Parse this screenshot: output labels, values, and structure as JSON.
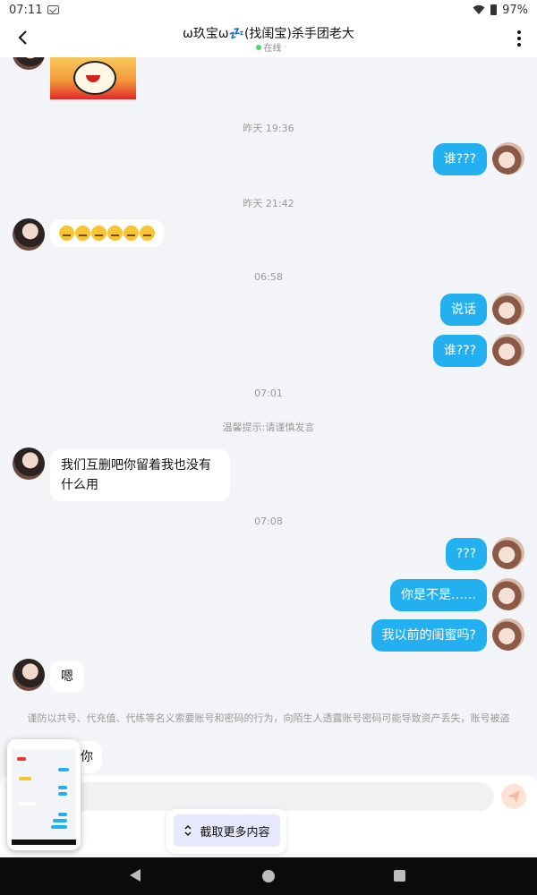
{
  "status_bar": {
    "time": "07:11",
    "battery": "97%"
  },
  "header": {
    "title": "ω玖宝ω💤(找闺宝)杀手团老大",
    "status": "在线"
  },
  "chat": {
    "timestamps": [
      "昨天 19:36",
      "昨天 21:42",
      "06:58",
      "07:01",
      "07:08"
    ],
    "warning_tip": "温馨提示:请谨慎发言",
    "security_notice": "谨防以共号、代充值、代练等名义索要账号和密码的行为，向陌生人透露账号密码可能导致资产丢失，账号被盗",
    "messages": {
      "out_1": "谁???",
      "out_2": "说话",
      "out_3": "谁???",
      "in_long": "我们互删吧你留着我也没有什么用",
      "out_4": "???",
      "out_5": "你是不是……",
      "out_6": "我以前的闺蜜吗?",
      "in_short": "嗯",
      "in_partial": "你"
    },
    "emoji_icons": [
      "persevering-face",
      "persevering-face",
      "persevering-face",
      "persevering-face",
      "persevering-face",
      "persevering-face"
    ]
  },
  "bottom": {
    "capture_label": "截取更多内容"
  },
  "colors": {
    "out_bubble": "#23b0f0",
    "in_bubble": "#ffffff",
    "background": "#f3f4f7"
  }
}
